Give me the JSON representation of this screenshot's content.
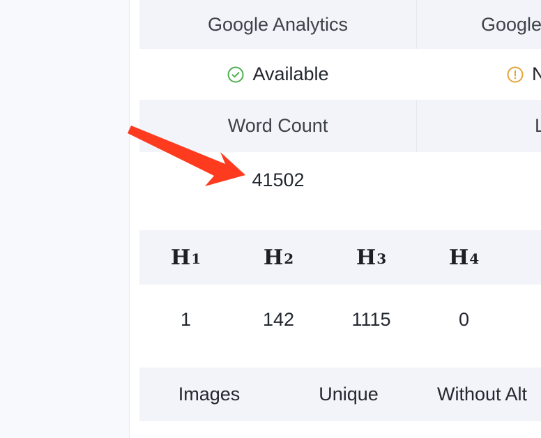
{
  "tools": {
    "google_analytics": "Google Analytics",
    "google_second": "Google"
  },
  "status": {
    "available_label": "Available",
    "second_label": "N",
    "available_color": "#4caf50",
    "warning_color": "#e6a23c",
    "available_icon": "check-circle-icon",
    "warning_icon": "warning-circle-icon"
  },
  "word_count": {
    "header": "Word Count",
    "second_header": "L",
    "value": "41502"
  },
  "headings": {
    "headers": [
      {
        "prefix": "H",
        "num": "1"
      },
      {
        "prefix": "H",
        "num": "2"
      },
      {
        "prefix": "H",
        "num": "3"
      },
      {
        "prefix": "H",
        "num": "4"
      }
    ],
    "values": [
      "1",
      "142",
      "1115",
      "0"
    ]
  },
  "images": {
    "headers": [
      "Images",
      "Unique",
      "Without Alt"
    ]
  },
  "annotation": {
    "arrow_color": "#ff3b1f"
  }
}
